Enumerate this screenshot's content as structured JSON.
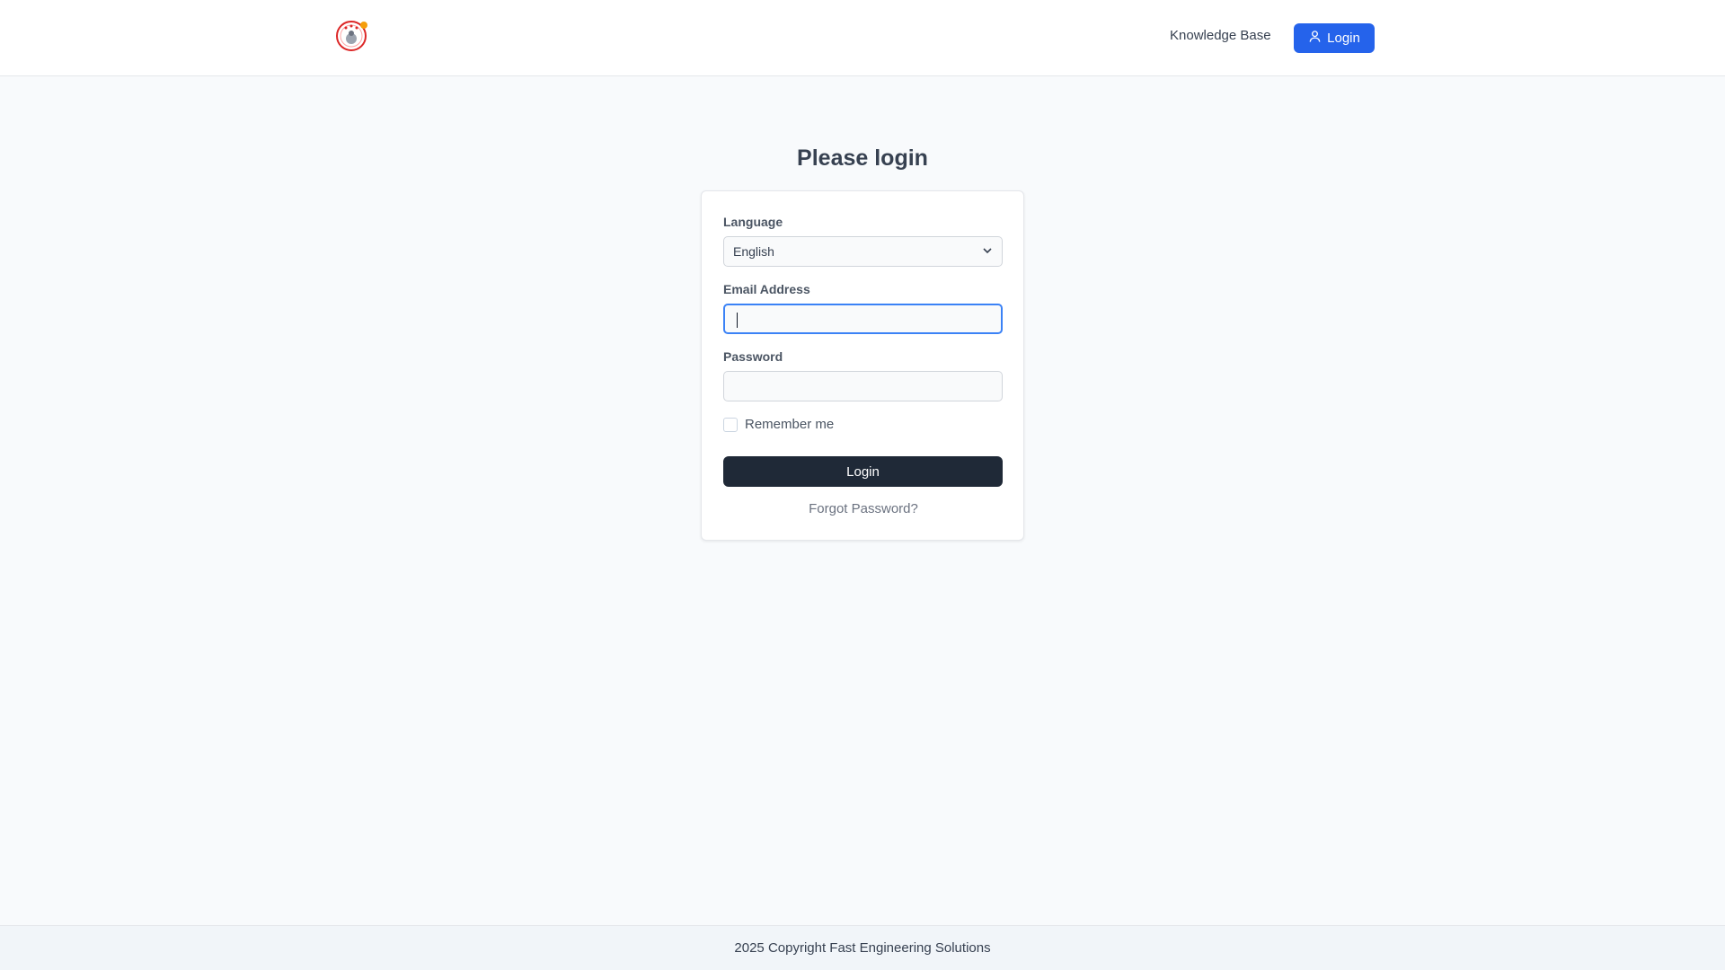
{
  "header": {
    "logo_icon": "company-logo",
    "knowledge_base_label": "Knowledge Base",
    "login_button_label": "Login",
    "login_icon": "user-icon",
    "accent_color": "#2563eb"
  },
  "main": {
    "title": "Please login",
    "language": {
      "label": "Language",
      "selected": "English",
      "icon": "chevron-down-icon"
    },
    "email": {
      "label": "Email Address",
      "value": ""
    },
    "password": {
      "label": "Password",
      "value": ""
    },
    "remember_me_label": "Remember me",
    "remember_me_checked": false,
    "submit_label": "Login",
    "forgot_password_label": "Forgot Password?",
    "submit_color": "#1f2937"
  },
  "footer": {
    "copyright": "2025 Copyright Fast Engineering Solutions"
  }
}
